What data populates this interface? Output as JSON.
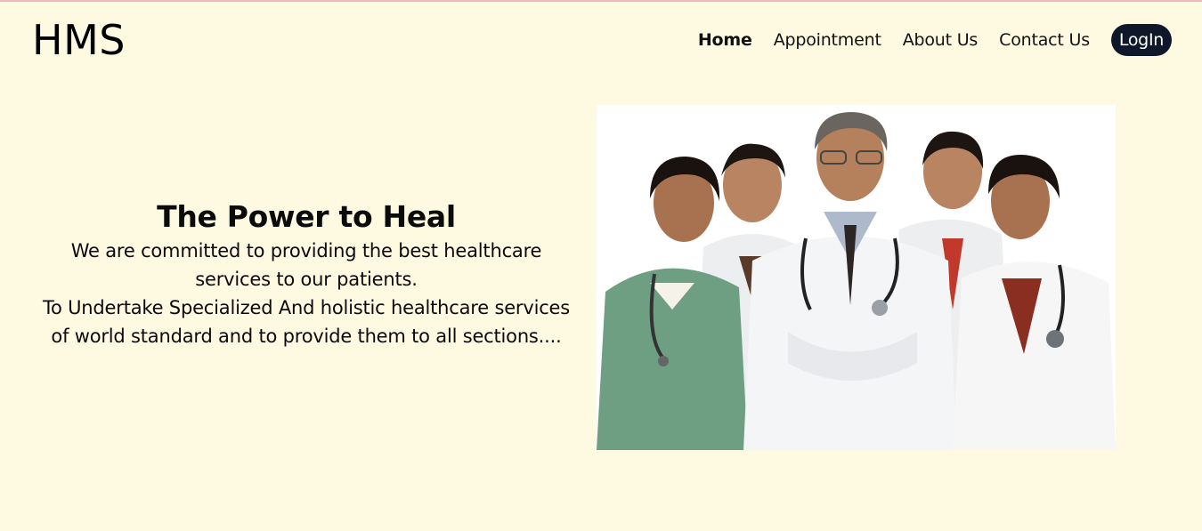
{
  "header": {
    "logo": "HMS",
    "nav": [
      {
        "label": "Home",
        "active": true
      },
      {
        "label": "Appointment",
        "active": false
      },
      {
        "label": "About Us",
        "active": false
      },
      {
        "label": "Contact Us",
        "active": false
      }
    ],
    "login_label": "LogIn"
  },
  "hero": {
    "title": "The Power to Heal",
    "lines": [
      "We are committed to providing the best healthcare services to our patients.",
      "To Undertake Specialized And holistic healthcare services of world standard and to provide them to all sections...."
    ]
  },
  "colors": {
    "background": "#fef9e1",
    "login_button": "#0f172a",
    "top_border": "#f2b8bf"
  }
}
